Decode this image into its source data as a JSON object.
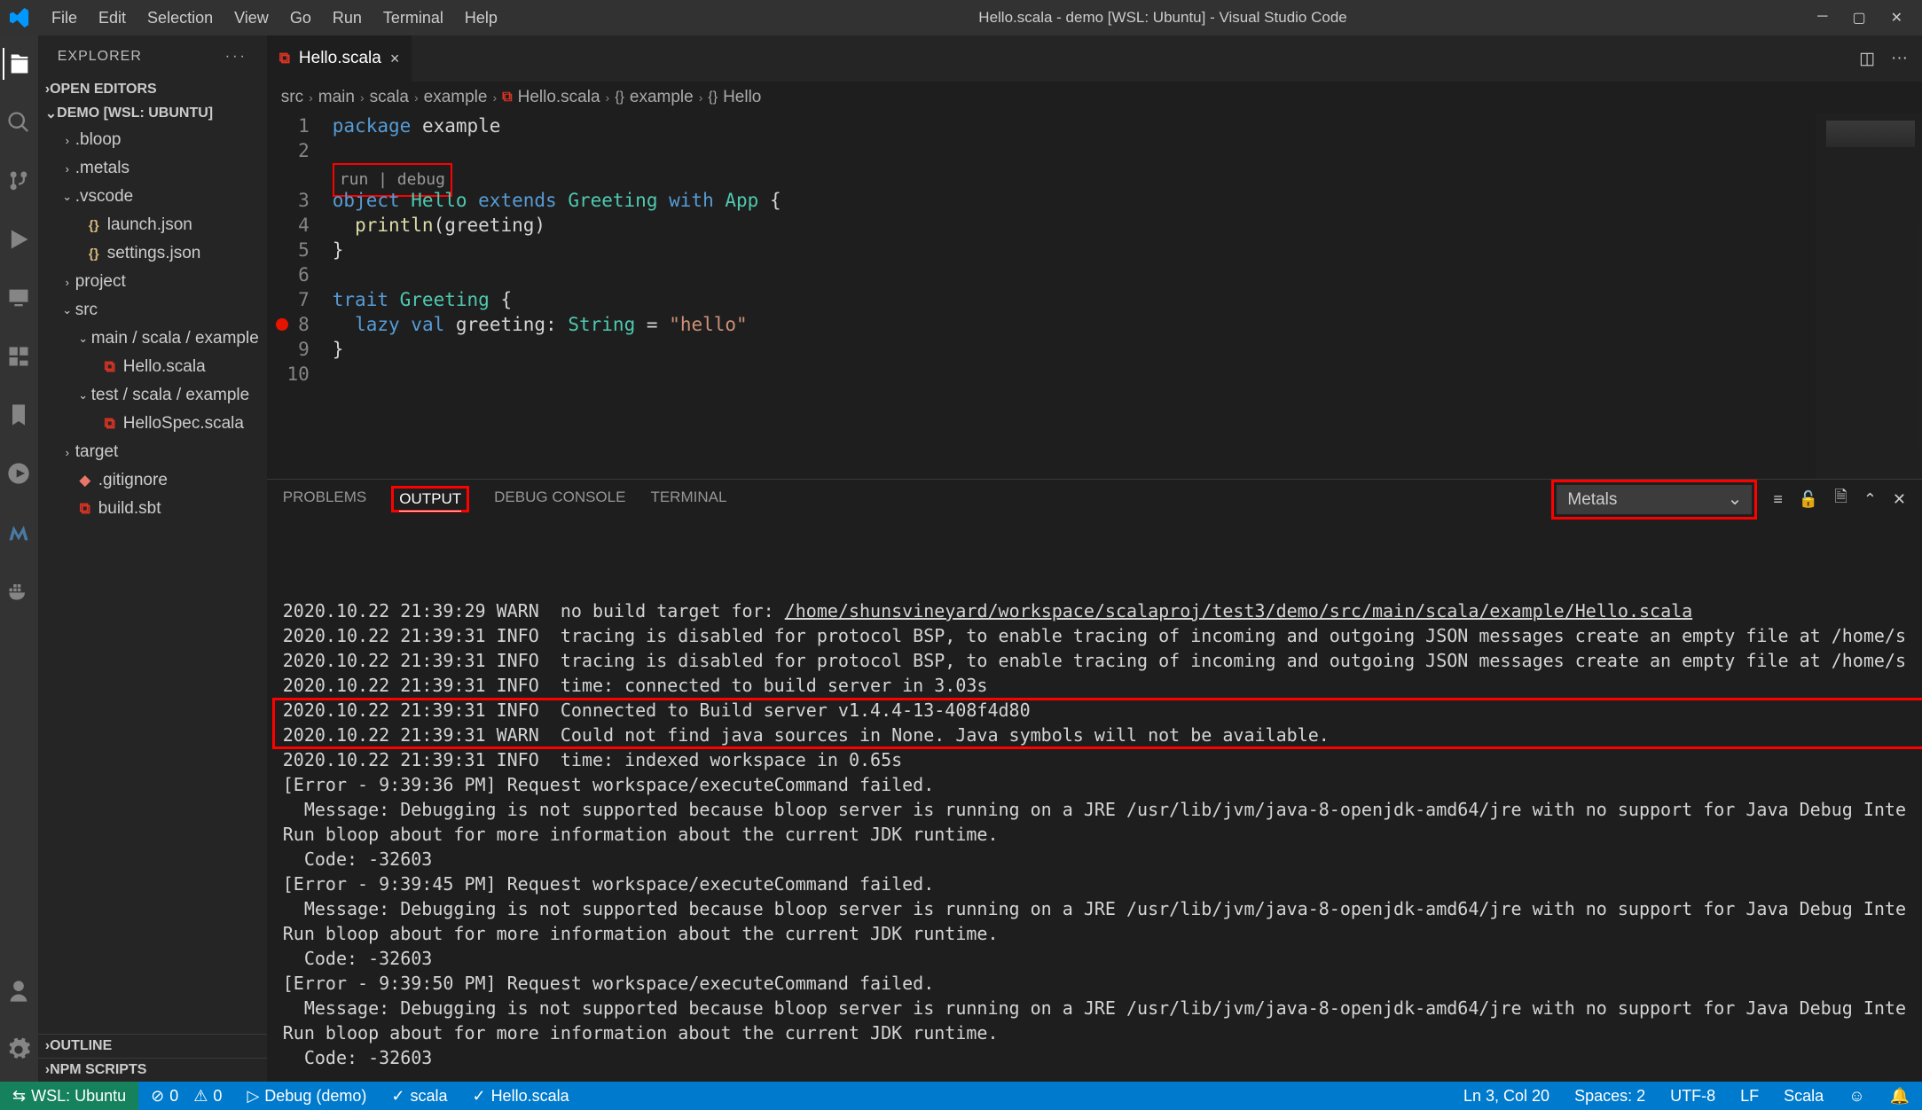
{
  "titlebar": {
    "menu": [
      "File",
      "Edit",
      "Selection",
      "View",
      "Go",
      "Run",
      "Terminal",
      "Help"
    ],
    "title": "Hello.scala - demo [WSL: Ubuntu] - Visual Studio Code"
  },
  "sidebar": {
    "header": "EXPLORER",
    "open_editors": "OPEN EDITORS",
    "workspace": "DEMO [WSL: UBUNTU]",
    "tree": {
      "bloop": ".bloop",
      "metals": ".metals",
      "vscode": ".vscode",
      "launch": "launch.json",
      "settings": "settings.json",
      "project": "project",
      "src": "src",
      "mainpath": "main / scala / example",
      "hello": "Hello.scala",
      "testpath": "test / scala / example",
      "hellospec": "HelloSpec.scala",
      "target": "target",
      "gitignore": ".gitignore",
      "buildsbt": "build.sbt"
    },
    "outline": "OUTLINE",
    "npm": "NPM SCRIPTS"
  },
  "tab": {
    "name": "Hello.scala"
  },
  "breadcrumbs": [
    "src",
    "main",
    "scala",
    "example",
    "Hello.scala",
    "example",
    "Hello"
  ],
  "codelens": "run | debug",
  "code": {
    "l1": {
      "a": "package",
      "b": "example"
    },
    "l3": {
      "a": "object",
      "b": "Hello",
      "c": "extends",
      "d": "Greeting",
      "e": "with",
      "f": "App",
      "g": "{"
    },
    "l4": {
      "a": "println",
      "b": "(",
      "c": "greeting",
      "d": ")"
    },
    "l5": "}",
    "l7": {
      "a": "trait",
      "b": "Greeting",
      "c": "{"
    },
    "l8": {
      "a": "lazy",
      "b": "val",
      "c": "greeting",
      "d": ":",
      "e": "String",
      "f": "=",
      "g": "\"hello\""
    },
    "l9": "}"
  },
  "panel": {
    "tabs": {
      "problems": "PROBLEMS",
      "output": "OUTPUT",
      "debug": "DEBUG CONSOLE",
      "terminal": "TERMINAL"
    },
    "channel": "Metals",
    "output_lines": [
      "2020.10.22 21:39:29 WARN  no build target for: /home/shunsvineyard/workspace/scalaproj/test3/demo/src/main/scala/example/Hello.scala",
      "2020.10.22 21:39:31 INFO  tracing is disabled for protocol BSP, to enable tracing of incoming and outgoing JSON messages create an empty file at /home/s",
      "2020.10.22 21:39:31 INFO  tracing is disabled for protocol BSP, to enable tracing of incoming and outgoing JSON messages create an empty file at /home/s",
      "2020.10.22 21:39:31 INFO  time: connected to build server in 3.03s",
      "2020.10.22 21:39:31 INFO  Connected to Build server v1.4.4-13-408f4d80",
      "2020.10.22 21:39:31 WARN  Could not find java sources in None. Java symbols will not be available.",
      "2020.10.22 21:39:31 INFO  time: indexed workspace in 0.65s",
      "[Error - 9:39:36 PM] Request workspace/executeCommand failed.",
      "  Message: Debugging is not supported because bloop server is running on a JRE /usr/lib/jvm/java-8-openjdk-amd64/jre with no support for Java Debug Inte",
      "",
      "Run bloop about for more information about the current JDK runtime.",
      "  Code: -32603",
      "[Error - 9:39:45 PM] Request workspace/executeCommand failed.",
      "  Message: Debugging is not supported because bloop server is running on a JRE /usr/lib/jvm/java-8-openjdk-amd64/jre with no support for Java Debug Inte",
      "",
      "Run bloop about for more information about the current JDK runtime.",
      "  Code: -32603",
      "[Error - 9:39:50 PM] Request workspace/executeCommand failed.",
      "  Message: Debugging is not supported because bloop server is running on a JRE /usr/lib/jvm/java-8-openjdk-amd64/jre with no support for Java Debug Inte",
      "",
      "Run bloop about for more information about the current JDK runtime.",
      "  Code: -32603"
    ]
  },
  "statusbar": {
    "remote": "WSL: Ubuntu",
    "errors": "0",
    "warnings": "0",
    "debug": "Debug (demo)",
    "lang": "scala",
    "file": "Hello.scala",
    "lncol": "Ln 3, Col 20",
    "spaces": "Spaces: 2",
    "encoding": "UTF-8",
    "eol": "LF",
    "mode": "Scala"
  }
}
